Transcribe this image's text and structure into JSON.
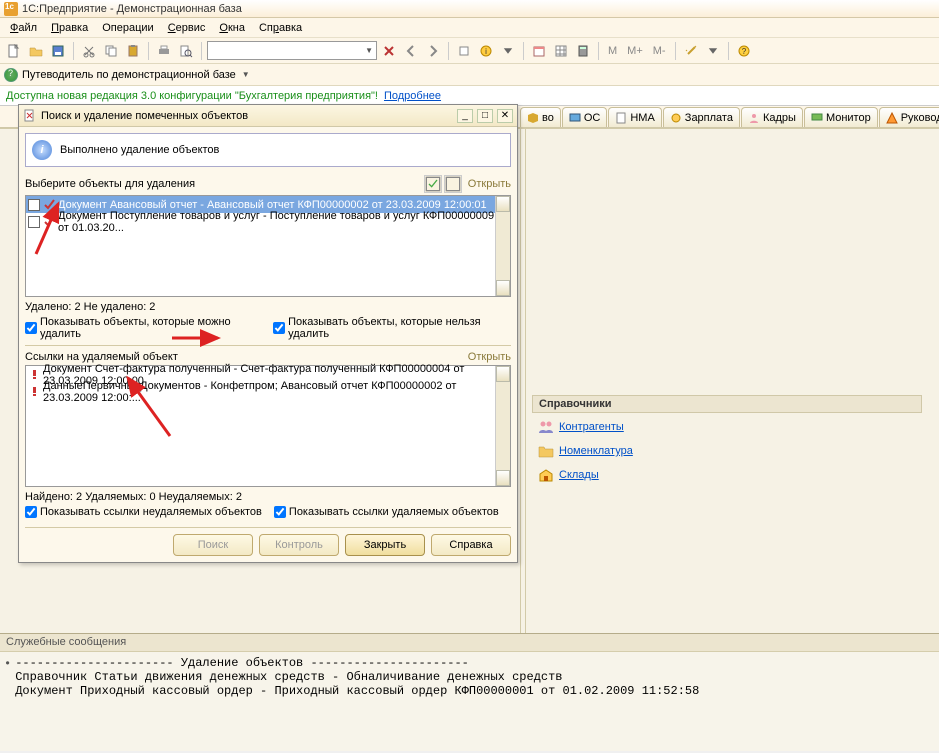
{
  "titlebar": {
    "text": "1С:Предприятие - Демонстрационная база"
  },
  "menu": {
    "file": "Файл",
    "edit": "Правка",
    "ops": "Операции",
    "svc": "Сервис",
    "win": "Окна",
    "help": "Справка"
  },
  "guide": {
    "label": "Путеводитель по демонстрационной базе"
  },
  "notice": {
    "msg": "Доступна новая редакция 3.0 конфигурации \"Бухгалтерия предприятия\"!",
    "link": "Подробнее"
  },
  "tabs": {
    "items": [
      {
        "icn": "cube",
        "label": "во"
      },
      {
        "icn": "cube",
        "label": "ОС"
      },
      {
        "icn": "doc",
        "label": "НМА"
      },
      {
        "icn": "coin",
        "label": "Зарплата"
      },
      {
        "icn": "person",
        "label": "Кадры"
      },
      {
        "icn": "screen",
        "label": "Монитор"
      },
      {
        "icn": "warn",
        "label": "Руководителю"
      }
    ]
  },
  "side": {
    "header": "Справочники",
    "items": [
      {
        "icn": "people",
        "label": "Контрагенты"
      },
      {
        "icn": "folder",
        "label": "Номенклатура"
      },
      {
        "icn": "house",
        "label": "Склады"
      }
    ]
  },
  "modal": {
    "title": "Поиск и удаление помеченных объектов",
    "info": "Выполнено удаление объектов",
    "list_label": "Выберите объекты для удаления",
    "open": "Открыть",
    "rows": [
      "Документ Авансовый отчет - Авансовый отчет КФП00000002 от 23.03.2009 12:00:01",
      "Документ Поступление товаров и услуг - Поступление товаров и услуг КФП00000009 от 01.03.20..."
    ],
    "del_status": "Удалено: 2  Не удалено: 2",
    "chk_candel": "Показывать объекты, которые можно удалить",
    "chk_cantdel": "Показывать объекты, которые нельзя удалить",
    "refs_title": "Ссылки на удаляемый объект",
    "ref_rows": [
      "Документ Счет-фактура полученный - Счет-фактура полученный КФП00000004 от 23.03.2009 12:00:00",
      "ДанныеПервичныхДокументов  - Конфетпром; Авансовый отчет КФП00000002 от 23.03.2009 12:00:..."
    ],
    "found_status": "Найдено: 2  Удаляемых: 0  Неудаляемых: 2",
    "chk_showref_nondel": "Показывать ссылки неудаляемых объектов",
    "chk_showref_del": "Показывать ссылки удаляемых объектов",
    "btn_search": "Поиск",
    "btn_control": "Контроль",
    "btn_close": "Закрыть",
    "btn_help": "Справка"
  },
  "msgs": {
    "header": "Служебные сообщения",
    "body_line1": "---------------------- Удаление объектов ----------------------",
    "body_line2": "Справочник Статьи движения денежных средств - Обналичивание денежных средств",
    "body_line3": "Документ Приходный кассовый ордер - Приходный кассовый ордер КФП00000001 от 01.02.2009 11:52:58"
  },
  "toolbar_m": {
    "m1": "M",
    "m2": "M+",
    "m3": "M-"
  }
}
